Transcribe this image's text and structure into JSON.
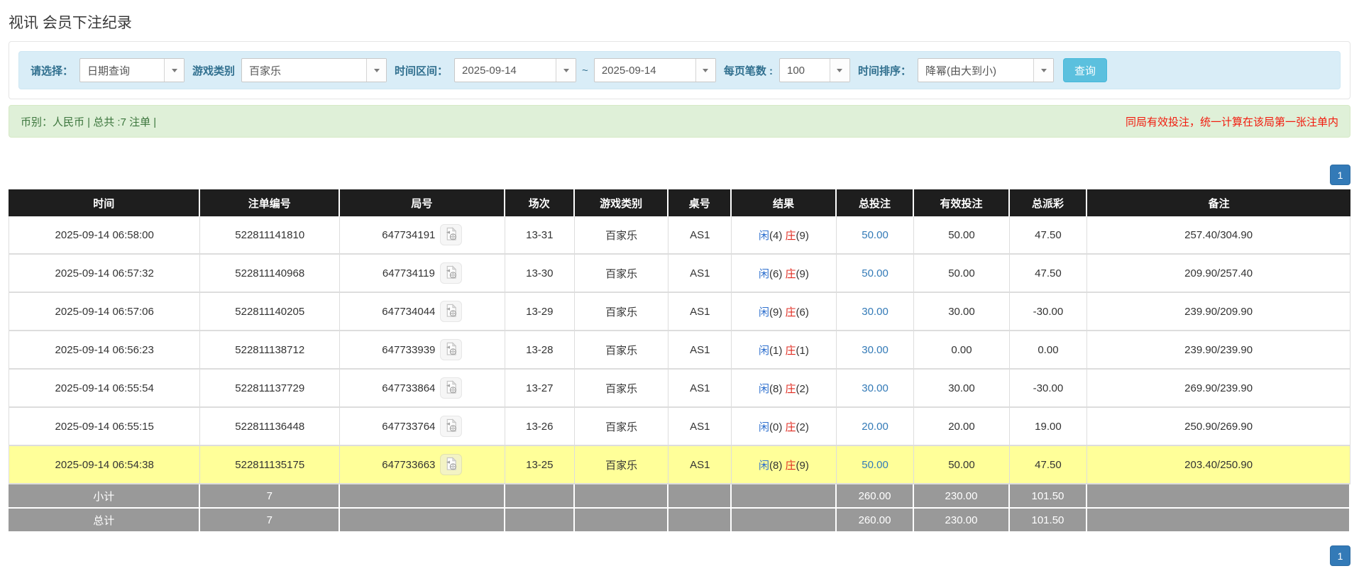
{
  "page_title": "视讯 会员下注纪录",
  "filters": {
    "select_label": "请选择：",
    "select_value": "日期查询",
    "game_type_label": "游戏类别",
    "game_type_value": "百家乐",
    "date_range_label": "时间区间：",
    "date_from": "2025-09-14",
    "date_separator": "~",
    "date_to": "2025-09-14",
    "page_size_label": "每页笔数 :",
    "page_size_value": "100",
    "sort_label": "时间排序：",
    "sort_value": "降幂(由大到小)",
    "search_button": "查询"
  },
  "summary_bar": {
    "left_text": "币别：人民币 | 总共 :7 注单 |",
    "right_text": "同局有效投注，统一计算在该局第一张注单内"
  },
  "pagination": {
    "page": "1"
  },
  "icons": {
    "dropdown": "chevron-down-icon",
    "round_video": "video-file-icon"
  },
  "colors": {
    "filter_bar_bg": "#d9edf7",
    "filter_label": "#31708f",
    "search_button_bg": "#5bc0de",
    "summary_bg": "#dff0d8",
    "summary_text": "#3c763d",
    "notice_text": "#f21b0e",
    "header_bg": "#1e1e1e",
    "highlight_row_bg": "#ffff99",
    "footer_bg": "#999999",
    "link_blue": "#337ab7",
    "player_blue": "#2d6fce",
    "banker_red": "#e02b20",
    "active_page_bg": "#337ab7"
  },
  "table": {
    "headers": [
      "时间",
      "注单编号",
      "局号",
      "场次",
      "游戏类别",
      "桌号",
      "结果",
      "总投注",
      "有效投注",
      "总派彩",
      "备注"
    ],
    "result_labels": {
      "player": "闲",
      "banker": "庄"
    },
    "rows": [
      {
        "time": "2025-09-14 06:58:00",
        "bet_id": "522811141810",
        "round_id": "647734191",
        "session": "13-31",
        "game": "百家乐",
        "table_no": "AS1",
        "player": "(4)",
        "banker": "(9)",
        "total_bet": "50.00",
        "valid_bet": "50.00",
        "payout": "47.50",
        "remark": "257.40/304.90",
        "highlight": false
      },
      {
        "time": "2025-09-14 06:57:32",
        "bet_id": "522811140968",
        "round_id": "647734119",
        "session": "13-30",
        "game": "百家乐",
        "table_no": "AS1",
        "player": "(6)",
        "banker": "(9)",
        "total_bet": "50.00",
        "valid_bet": "50.00",
        "payout": "47.50",
        "remark": "209.90/257.40",
        "highlight": false
      },
      {
        "time": "2025-09-14 06:57:06",
        "bet_id": "522811140205",
        "round_id": "647734044",
        "session": "13-29",
        "game": "百家乐",
        "table_no": "AS1",
        "player": "(9)",
        "banker": "(6)",
        "total_bet": "30.00",
        "valid_bet": "30.00",
        "payout": "-30.00",
        "remark": "239.90/209.90",
        "highlight": false
      },
      {
        "time": "2025-09-14 06:56:23",
        "bet_id": "522811138712",
        "round_id": "647733939",
        "session": "13-28",
        "game": "百家乐",
        "table_no": "AS1",
        "player": "(1)",
        "banker": "(1)",
        "total_bet": "30.00",
        "valid_bet": "0.00",
        "payout": "0.00",
        "remark": "239.90/239.90",
        "highlight": false
      },
      {
        "time": "2025-09-14 06:55:54",
        "bet_id": "522811137729",
        "round_id": "647733864",
        "session": "13-27",
        "game": "百家乐",
        "table_no": "AS1",
        "player": "(8)",
        "banker": "(2)",
        "total_bet": "30.00",
        "valid_bet": "30.00",
        "payout": "-30.00",
        "remark": "269.90/239.90",
        "highlight": false
      },
      {
        "time": "2025-09-14 06:55:15",
        "bet_id": "522811136448",
        "round_id": "647733764",
        "session": "13-26",
        "game": "百家乐",
        "table_no": "AS1",
        "player": "(0)",
        "banker": "(2)",
        "total_bet": "20.00",
        "valid_bet": "20.00",
        "payout": "19.00",
        "remark": "250.90/269.90",
        "highlight": false
      },
      {
        "time": "2025-09-14 06:54:38",
        "bet_id": "522811135175",
        "round_id": "647733663",
        "session": "13-25",
        "game": "百家乐",
        "table_no": "AS1",
        "player": "(8)",
        "banker": "(9)",
        "total_bet": "50.00",
        "valid_bet": "50.00",
        "payout": "47.50",
        "remark": "203.40/250.90",
        "highlight": true
      }
    ],
    "footer_rows": [
      {
        "label": "小计",
        "count": "7",
        "total_bet": "260.00",
        "valid_bet": "230.00",
        "payout": "101.50"
      },
      {
        "label": "总计",
        "count": "7",
        "total_bet": "260.00",
        "valid_bet": "230.00",
        "payout": "101.50"
      }
    ]
  }
}
